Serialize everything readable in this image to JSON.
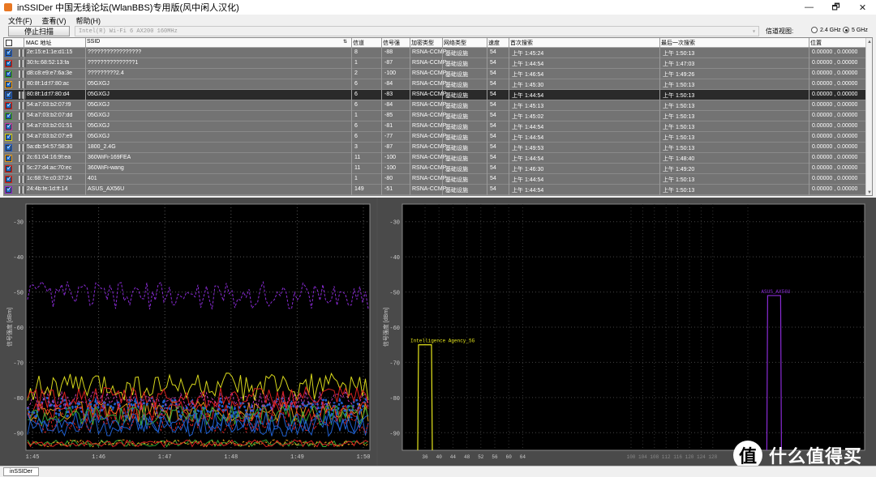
{
  "window": {
    "title": "inSSIDer 中国无线论坛(WlanBBS)专用版(风中闲人汉化)",
    "buttons": [
      "—",
      "🗗",
      "✕"
    ]
  },
  "menu": [
    "文件(F)",
    "查看(V)",
    "帮助(H)"
  ],
  "toolbar": {
    "stop_label": "停止扫描",
    "adapter": "Intel(R) Wi-Fi 6 AX200 160MHz",
    "band_label": "信道视图:",
    "band_24": "2.4 GHz",
    "band_5": "5 GHz",
    "band_selected": "5 GHz"
  },
  "table": {
    "headers": {
      "mac": "MAC 地址",
      "ssid": "SSID",
      "channel": "信道",
      "rssi": "信号强",
      "security": "加密类型",
      "network": "网络类型",
      "speed": "速度",
      "first_seen": "首次搜索",
      "last_seen": "最后一次搜索",
      "position": "位置"
    },
    "rows": [
      {
        "color": "#1f5fcf",
        "mac": "2e:15:e1:1e:d1:15",
        "ssid": "?????????????????",
        "channel": "8",
        "rssi": "-88",
        "security": "RSNA-CCMP",
        "network": "基础设施",
        "speed": "54",
        "first_seen": "上午 1:45:24",
        "last_seen": "上午 1:50:13",
        "position": "0.00000 , 0.00000"
      },
      {
        "color": "#d62020",
        "mac": "30:fc:68:52:13:fa",
        "ssid": "???????????????1",
        "channel": "1",
        "rssi": "-87",
        "security": "RSNA-CCMP",
        "network": "基础设施",
        "speed": "54",
        "first_seen": "上午 1:44:54",
        "last_seen": "上午 1:47:03",
        "position": "0.00000 , 0.00000"
      },
      {
        "color": "#35a835",
        "mac": "d8:c8:e9:e7:6a:3e",
        "ssid": "?????????2.4",
        "channel": "2",
        "rssi": "-100",
        "security": "RSNA-CCMP",
        "network": "基础设施",
        "speed": "54",
        "first_seen": "上午 1:46:54",
        "last_seen": "上午 1:49:26",
        "position": "0.00000 , 0.00000"
      },
      {
        "color": "#e69a1c",
        "mac": "80:8f:1d:f7:80:ac",
        "ssid": "05GXGJ",
        "channel": "6",
        "rssi": "-84",
        "security": "RSNA-CCMP",
        "network": "基础设施",
        "speed": "54",
        "first_seen": "上午 1:45:30",
        "last_seen": "上午 1:50:13",
        "position": "0.00000 , 0.00000"
      },
      {
        "color": "#1f5fcf",
        "mac": "80:8f:1d:f7:80:d4",
        "ssid": "05GXGJ",
        "channel": "6",
        "rssi": "-83",
        "security": "RSNA-CCMP",
        "network": "基础设施",
        "speed": "54",
        "first_seen": "上午 1:44:54",
        "last_seen": "上午 1:50:13",
        "position": "0.00000 , 0.00000",
        "selected": true
      },
      {
        "color": "#d62020",
        "mac": "54:a7:03:b2:07:f9",
        "ssid": "05GXGJ",
        "channel": "6",
        "rssi": "-84",
        "security": "RSNA-CCMP",
        "network": "基础设施",
        "speed": "54",
        "first_seen": "上午 1:45:13",
        "last_seen": "上午 1:50:13",
        "position": "0.00000 , 0.00000"
      },
      {
        "color": "#35a835",
        "mac": "54:a7:03:b2:07:dd",
        "ssid": "05GXGJ",
        "channel": "1",
        "rssi": "-85",
        "security": "RSNA-CCMP",
        "network": "基础设施",
        "speed": "54",
        "first_seen": "上午 1:45:02",
        "last_seen": "上午 1:50:13",
        "position": "0.00000 , 0.00000"
      },
      {
        "color": "#c03aa8",
        "mac": "54:a7:03:b2:01:51",
        "ssid": "05GXGJ",
        "channel": "6",
        "rssi": "-81",
        "security": "RSNA-CCMP",
        "network": "基础设施",
        "speed": "54",
        "first_seen": "上午 1:44:54",
        "last_seen": "上午 1:50:13",
        "position": "0.00000 , 0.00000"
      },
      {
        "color": "#d6d61c",
        "mac": "54:a7:03:b2:07:e9",
        "ssid": "05GXGJ",
        "channel": "6",
        "rssi": "-77",
        "security": "RSNA-CCMP",
        "network": "基础设施",
        "speed": "54",
        "first_seen": "上午 1:44:54",
        "last_seen": "上午 1:50:13",
        "position": "0.00000 , 0.00000"
      },
      {
        "color": "#1f5fcf",
        "mac": "5a:db:54:57:58:30",
        "ssid": "1800_2.4G",
        "channel": "3",
        "rssi": "-87",
        "security": "RSNA-CCMP",
        "network": "基础设施",
        "speed": "54",
        "first_seen": "上午 1:49:53",
        "last_seen": "上午 1:50:13",
        "position": "0.00000 , 0.00000"
      },
      {
        "color": "#e69a1c",
        "mac": "2c:61:04:16:9f:ea",
        "ssid": "360WiFi-169FEA",
        "channel": "11",
        "rssi": "-100",
        "security": "RSNA-CCMP",
        "network": "基础设施",
        "speed": "54",
        "first_seen": "上午 1:44:54",
        "last_seen": "上午 1:48:40",
        "position": "0.00000 , 0.00000"
      },
      {
        "color": "#d62020",
        "mac": "5c:27:d4:ac:70:ec",
        "ssid": "360WiFi-wang",
        "channel": "11",
        "rssi": "-100",
        "security": "RSNA-CCMP",
        "network": "基础设施",
        "speed": "54",
        "first_seen": "上午 1:46:30",
        "last_seen": "上午 1:49:20",
        "position": "0.00000 , 0.00000"
      },
      {
        "color": "#d62020",
        "mac": "1c:68:7e:c0:37:24",
        "ssid": "401",
        "channel": "1",
        "rssi": "-80",
        "security": "RSNA-CCMP",
        "network": "基础设施",
        "speed": "54",
        "first_seen": "上午 1:44:54",
        "last_seen": "上午 1:50:13",
        "position": "0.00000 , 0.00000"
      },
      {
        "color": "#8a2bd6",
        "mac": "24:4b:fe:1d:ff:14",
        "ssid": "ASUS_AX56U",
        "channel": "149",
        "rssi": "-51",
        "security": "RSNA-CCMP",
        "network": "基础设施",
        "speed": "54",
        "first_seen": "上午 1:44:54",
        "last_seen": "上午 1:50:13",
        "position": "0.00000 , 0.00000"
      }
    ]
  },
  "time_chart": {
    "ylabel": "信号强度 [dBm]",
    "y_ticks": [
      "-30",
      "-40",
      "-50",
      "-60",
      "-70",
      "-80",
      "-90"
    ],
    "x_ticks": [
      "1:45",
      "1:46",
      "1:47",
      "1:48",
      "1:49",
      "1:50"
    ]
  },
  "channel_chart": {
    "ylabel": "信号强度 [dBm]",
    "y_ticks": [
      "-30",
      "-40",
      "-50",
      "-60",
      "-70",
      "-80",
      "-90"
    ],
    "x_ticks": [
      "36",
      "40",
      "44",
      "48",
      "52",
      "56",
      "60",
      "64",
      "100",
      "104",
      "108",
      "112",
      "116",
      "120",
      "124",
      "128",
      "140"
    ],
    "networks": [
      {
        "name": "Intelligence Agency_5G",
        "channel": 36,
        "rssi": -65,
        "color": "#e6e61c"
      },
      {
        "name": "ASUS_AX56U",
        "channel": 149,
        "rssi": -51,
        "color": "#8a2bd6"
      }
    ]
  },
  "status_tab": "inSSIDer",
  "watermark": {
    "logo": "值",
    "text": "什么值得买"
  }
}
